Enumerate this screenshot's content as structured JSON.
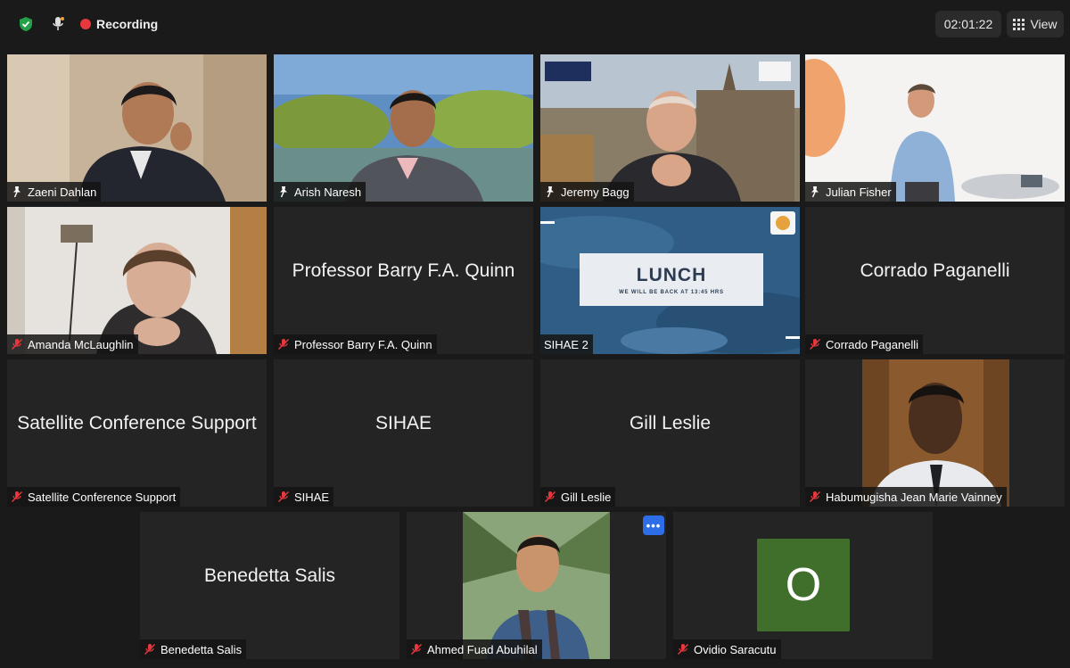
{
  "topbar": {
    "recording_label": "Recording",
    "timer": "02:01:22",
    "view_label": "View"
  },
  "participants": [
    {
      "name": "Zaeni Dahlan",
      "video": true,
      "muted": false,
      "pinned": true
    },
    {
      "name": "Arish Naresh",
      "video": true,
      "muted": false,
      "pinned": true
    },
    {
      "name": "Jeremy Bagg",
      "video": true,
      "muted": false,
      "pinned": true
    },
    {
      "name": "Julian Fisher",
      "video": true,
      "muted": false,
      "pinned": true,
      "active_speaker": true
    },
    {
      "name": "Amanda McLaughlin",
      "video": true,
      "muted": true
    },
    {
      "name": "Professor Barry F.A. Quinn",
      "video": false,
      "muted": true
    },
    {
      "name": "SIHAE 2",
      "video": true,
      "muted": false,
      "shared_slide": {
        "title": "LUNCH",
        "subtitle": "WE WILL BE BACK AT 13:45 HRS"
      }
    },
    {
      "name": "Corrado Paganelli",
      "video": false,
      "muted": true
    },
    {
      "name": "Satellite Conference Support",
      "video": false,
      "muted": true
    },
    {
      "name": "SIHAE",
      "video": false,
      "muted": true
    },
    {
      "name": "Gill Leslie",
      "video": false,
      "muted": true
    },
    {
      "name": "Habumugisha Jean Marie Vainney",
      "video": true,
      "muted": true
    },
    {
      "name": "Benedetta Salis",
      "video": false,
      "muted": true
    },
    {
      "name": "Ahmed Fuad Abuhilal",
      "video": true,
      "muted": true
    },
    {
      "name": "Ovidio Saracutu",
      "video": false,
      "muted": true,
      "avatar_letter": "O"
    }
  ],
  "colors": {
    "recording_dot": "#e8373d",
    "active_speaker_border": "#c9e16d",
    "muted_icon": "#e8373d",
    "avatar_bg": "#3f6f2b",
    "more_button": "#2d6ee8"
  },
  "icons": {
    "security": "shield-check-icon",
    "mic": "microphone-icon",
    "view": "grid-icon",
    "pin": "pin-icon",
    "muted": "mic-muted-icon",
    "more": "more-options-icon"
  }
}
